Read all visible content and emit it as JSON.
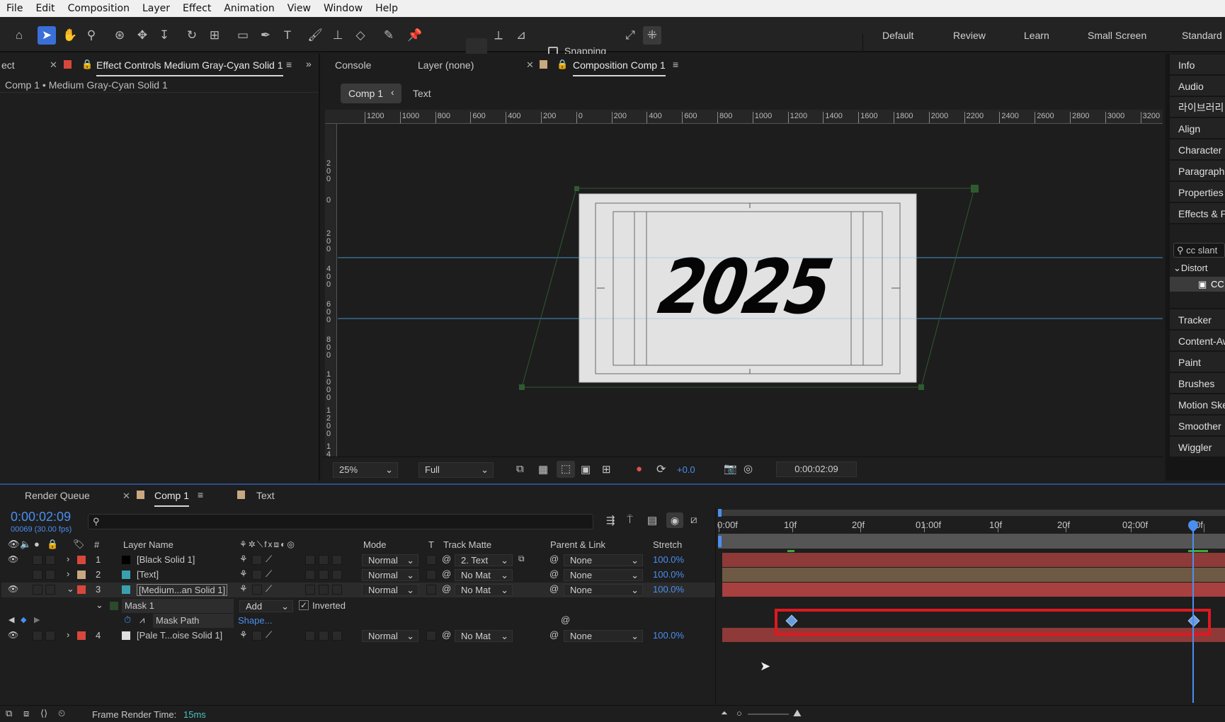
{
  "menu": [
    "File",
    "Edit",
    "Composition",
    "Layer",
    "Effect",
    "Animation",
    "View",
    "Window",
    "Help"
  ],
  "toolbar": {
    "snapping_label": "Snapping",
    "workspaces": [
      "Default",
      "Review",
      "Learn",
      "Small Screen",
      "Standard"
    ]
  },
  "effect_controls": {
    "tab_prev": "ect",
    "tab_label": "Effect Controls Medium Gray-Cyan Solid 1",
    "breadcrumb": "Comp 1 • Medium Gray-Cyan Solid 1"
  },
  "viewer": {
    "tabs": [
      "Console",
      "Layer (none)",
      "Composition Comp 1"
    ],
    "comp_nav": [
      "Comp 1",
      "Text"
    ],
    "ruler_labels": [
      "1200",
      "1000",
      "800",
      "600",
      "400",
      "200",
      "0",
      "200",
      "400",
      "600",
      "800",
      "1000",
      "1200",
      "1400",
      "1600",
      "1800",
      "2000",
      "2200",
      "2400",
      "2600",
      "2800",
      "3000",
      "3200"
    ],
    "vruler_labels": [
      "200",
      "0",
      "200",
      "400",
      "600",
      "800",
      "1000",
      "1200",
      "14"
    ],
    "canvas_text": "2025",
    "zoom": "25%",
    "resolution": "Full",
    "exposure": "+0.0",
    "timecode": "0:00:02:09"
  },
  "right_panels": [
    "Info",
    "Audio",
    "라이브러리",
    "Align",
    "Character",
    "Paragraph",
    "Properties",
    "Effects & Presets",
    "Tracker",
    "Content-Aware Fill",
    "Paint",
    "Brushes",
    "Motion Sketch",
    "Smoother",
    "Wiggler"
  ],
  "effects_search": "cc slant",
  "effects_category": "Distort",
  "effects_item": "CC",
  "timeline": {
    "tabs": [
      "Render Queue",
      "Comp 1",
      "Text"
    ],
    "timecode": "0:00:02:09",
    "frame_info": "00069 (30.00 fps)",
    "search_placeholder": "",
    "columns": {
      "num": "#",
      "layer_name": "Layer Name",
      "mode": "Mode",
      "t": "T",
      "track_matte": "Track Matte",
      "parent": "Parent & Link",
      "stretch": "Stretch"
    },
    "layers": [
      {
        "num": "1",
        "name": "[Black Solid 1]",
        "mode": "Normal",
        "matte": "2. Text",
        "parent": "None",
        "stretch": "100.0%",
        "label_color": "#d8473c"
      },
      {
        "num": "2",
        "name": "[Text]",
        "mode": "Normal",
        "matte": "No Mat",
        "parent": "None",
        "stretch": "100.0%",
        "label_color": "#c8a880"
      },
      {
        "num": "3",
        "name": "[Medium...an Solid 1]",
        "mode": "Normal",
        "matte": "No Mat",
        "parent": "None",
        "stretch": "100.0%",
        "label_color": "#d8473c"
      },
      {
        "num": "4",
        "name": "[Pale T...oise Solid 1]",
        "mode": "Normal",
        "matte": "No Mat",
        "parent": "None",
        "stretch": "100.0%",
        "label_color": "#d8473c"
      }
    ],
    "mask": {
      "name": "Mask 1",
      "mode": "Add",
      "inverted_label": "Inverted",
      "inverted": true
    },
    "mask_path": {
      "label": "Mask Path",
      "value": "Shape..."
    },
    "ruler_ticks": [
      "0:00f",
      "10f",
      "20f",
      "01:00f",
      "10f",
      "20f",
      "02:00f",
      "0f"
    ],
    "frame_render_label": "Frame Render Time:",
    "frame_render_value": "15ms"
  }
}
